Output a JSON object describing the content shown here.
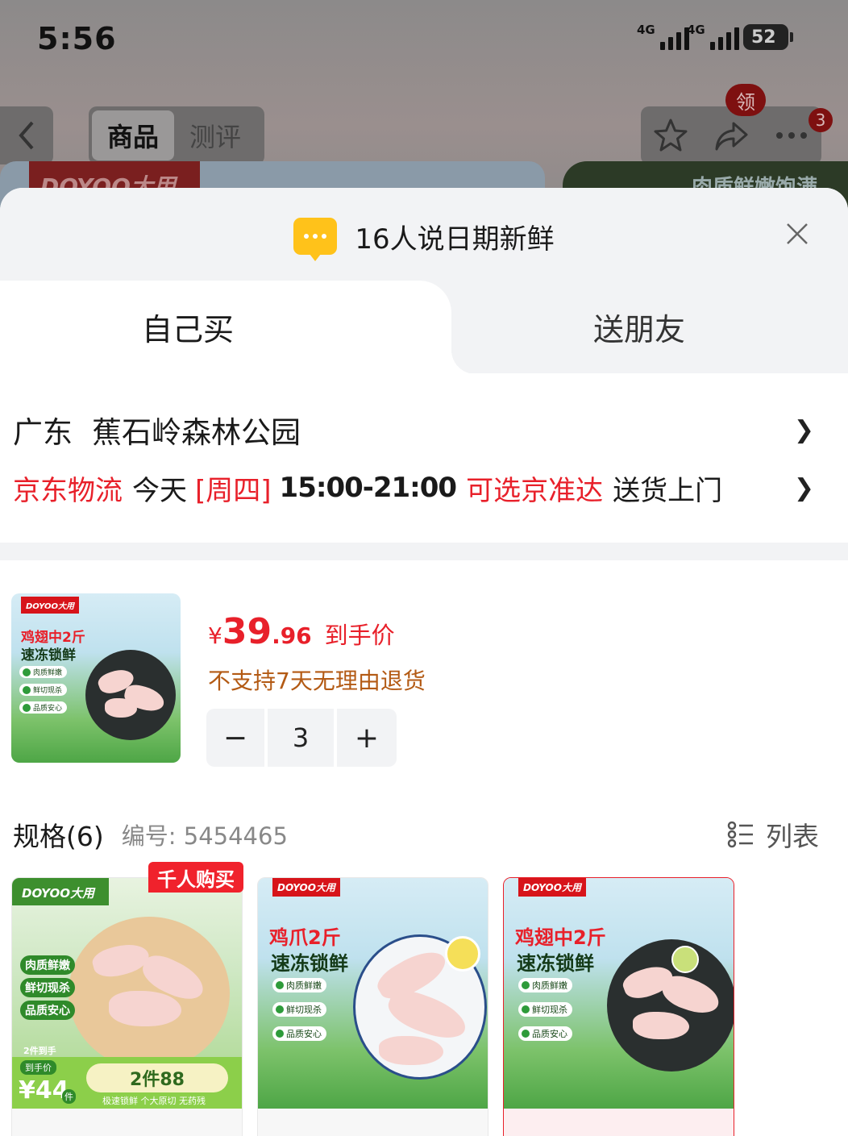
{
  "status_bar": {
    "time": "5:56",
    "signal1_label": "4G",
    "signal2_label": "4G",
    "battery": "52"
  },
  "nav": {
    "tabs": [
      {
        "label": "商品",
        "active": true
      },
      {
        "label": "测评",
        "active": false
      }
    ],
    "coupon_badge": "领",
    "message_count": "3",
    "icons": [
      "back-chevron-icon",
      "star-icon",
      "share-icon",
      "more-icon"
    ]
  },
  "background_page": {
    "brand": "DOYOO大用",
    "banner_text": "肉质鲜嫩饱满"
  },
  "sheet": {
    "notice": "16人说日期新鲜",
    "buy_tabs": [
      {
        "label": "自己买",
        "active": true
      },
      {
        "label": "送朋友",
        "active": false
      }
    ],
    "address": {
      "province": "广东",
      "place": "蕉石岭森林公园"
    },
    "delivery": {
      "carrier": "京东物流",
      "day": "今天",
      "weekday": "[周四]",
      "window": "15:00-21:00",
      "option": "可选京准达",
      "method": "送货上门"
    },
    "product": {
      "price_currency": "¥",
      "price_integer": "39",
      "price_decimal": ".96",
      "price_label": "到手价",
      "return_note": "不支持7天无理由退货",
      "quantity": "3",
      "minus": "−",
      "plus": "+"
    },
    "spec": {
      "title": "规格(6)",
      "code": "编号: 5454465",
      "list_toggle": "列表",
      "hot_tag": "千人购买"
    },
    "cards": [
      {
        "brand": "DOYOO大用",
        "features": [
          "肉质鲜嫩",
          "鲜切现杀",
          "品质安心"
        ],
        "promo_top": "2件到手",
        "promo_label": "到手价",
        "promo_price": "¥44",
        "promo_unit": "件",
        "promo_deal": "2件88",
        "promo_foot": "极速锁鲜 个大原切 无药残",
        "selected": false
      },
      {
        "brand": "DOYOO大用",
        "title_red": "鸡爪2斤",
        "title_dark": "速冻锁鲜",
        "features": [
          "肉质鲜嫩",
          "鲜切现杀",
          "品质安心"
        ],
        "selected": false
      },
      {
        "brand": "DOYOO大用",
        "title_red": "鸡翅中2斤",
        "title_dark": "速冻锁鲜",
        "features": [
          "肉质鲜嫩",
          "鲜切现杀",
          "品质安心"
        ],
        "selected": true
      }
    ],
    "thumb": {
      "brand": "DOYOO大用",
      "title_red": "鸡翅中2斤",
      "title_dark": "速冻锁鲜",
      "features": [
        "肉质鲜嫩",
        "鲜切现杀",
        "品质安心"
      ]
    }
  },
  "colors": {
    "accent_red": "#e8202a",
    "warning_brown": "#b35a14",
    "sheet_gray": "#f2f3f5"
  }
}
